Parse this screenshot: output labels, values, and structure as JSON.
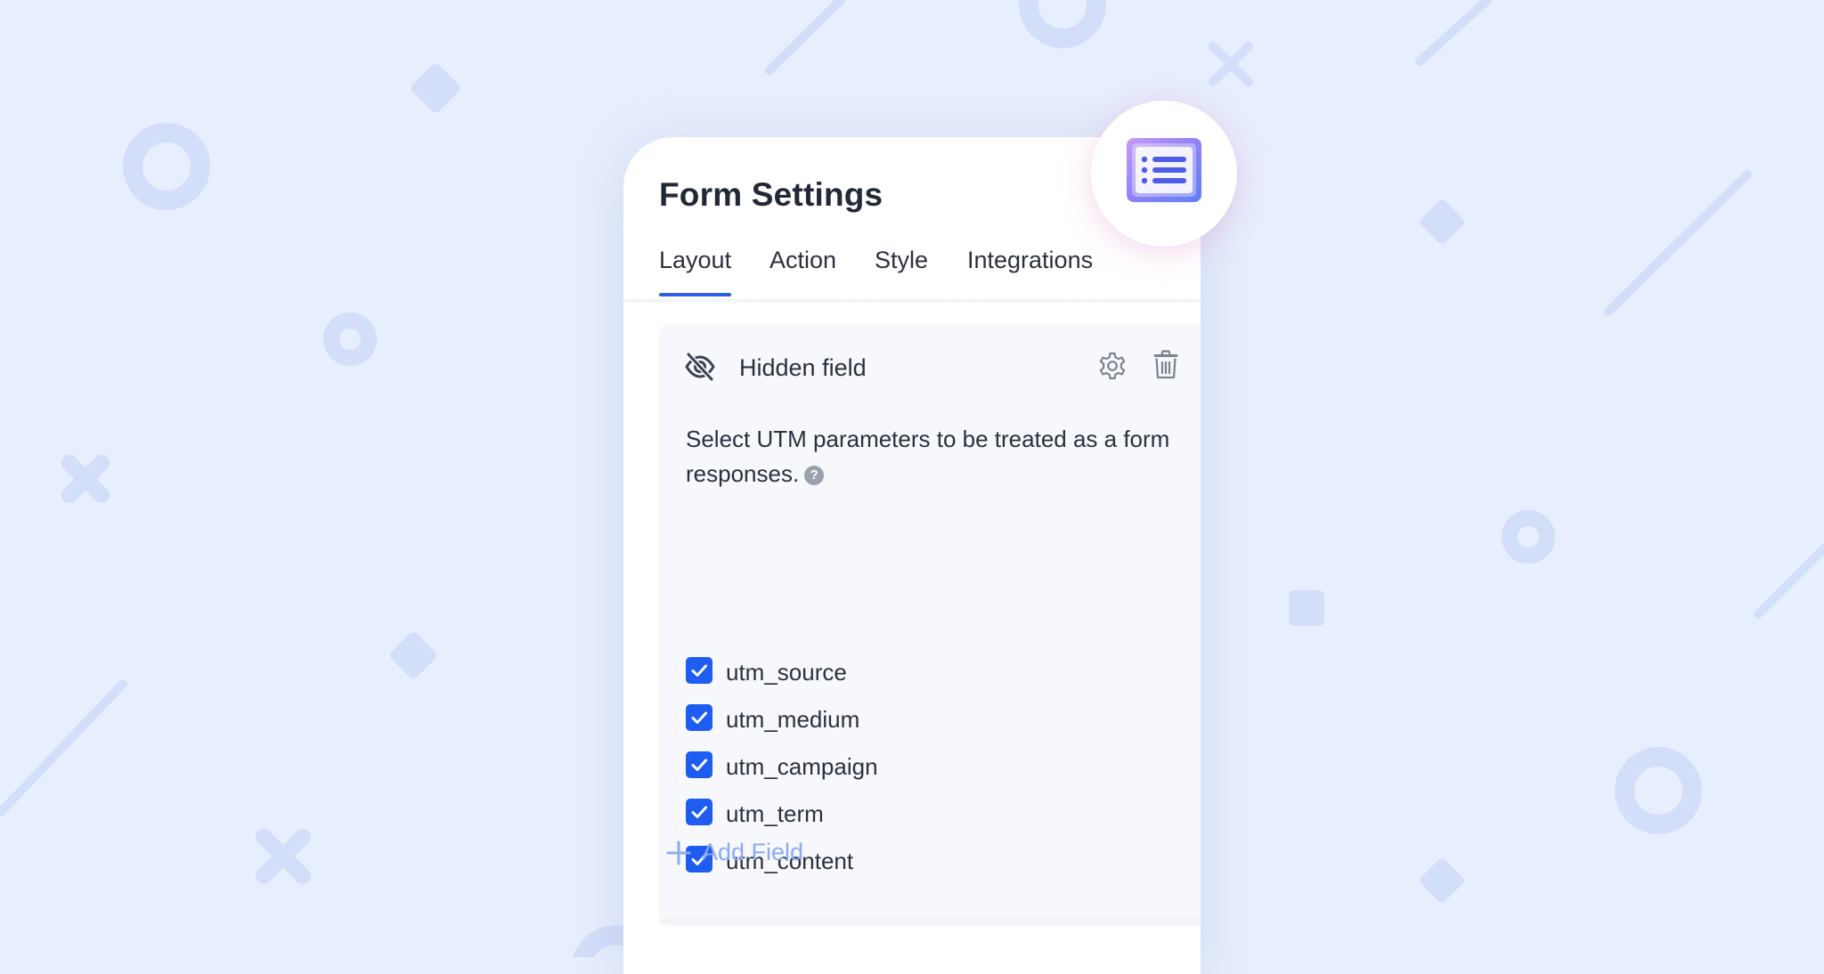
{
  "app": {
    "title": "Form Settings",
    "tabs": [
      {
        "label": "Layout",
        "active": true
      },
      {
        "label": "Action",
        "active": false
      },
      {
        "label": "Style",
        "active": false
      },
      {
        "label": "Integrations",
        "active": false
      }
    ]
  },
  "field": {
    "label": "Hidden field",
    "icon": "eye-slash-icon",
    "actions": [
      "gear-icon",
      "trash-icon"
    ],
    "description": "Select UTM parameters to be treated as a form responses.",
    "help_icon": "question-icon",
    "help_glyph": "?",
    "options": [
      {
        "label": "utm_source",
        "checked": true
      },
      {
        "label": "utm_medium",
        "checked": true
      },
      {
        "label": "utm_campaign",
        "checked": true
      },
      {
        "label": "utm_term",
        "checked": true
      },
      {
        "label": "utm_content",
        "checked": true
      }
    ]
  },
  "add_field": {
    "label": "Add Field",
    "icon": "plus-icon"
  },
  "badge": {
    "icon": "form-list-icon"
  },
  "colors": {
    "accent": "#1f5cf2",
    "tab_underline": "#2f5ee6",
    "background": "#e7eefd",
    "add_field_text": "#8faaf3"
  }
}
